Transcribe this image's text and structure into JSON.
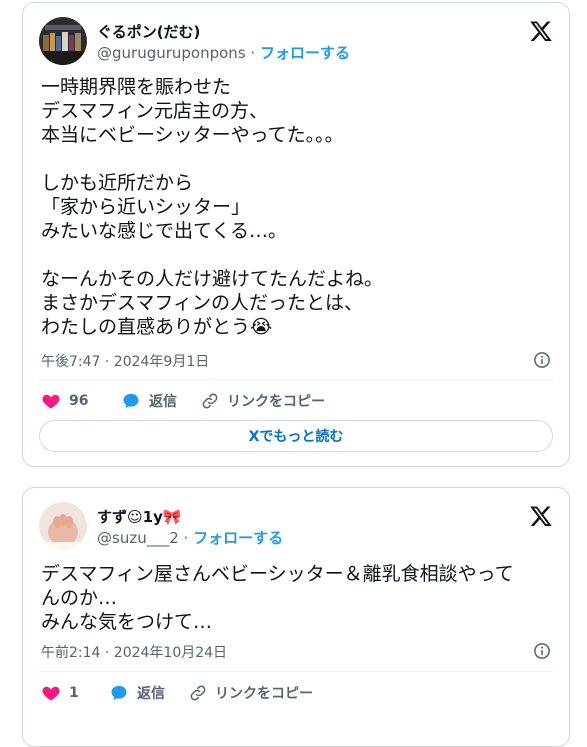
{
  "tweets": [
    {
      "display_name": "ぐるポン(だむ)",
      "handle": "@guruguruponpons",
      "separator": "·",
      "follow_label": "フォローする",
      "text": "一時期界隈を賑わせた\nデスマフィン元店主の方、\n本当にベビーシッターやってた。。。\n\nしかも近所だから\n「家から近いシッター」\nみたいな感じで出てくる…。\n\nなーんかその人だけ避けてたんだよね。\nまさかデスマフィンの人だったとは、\nわたしの直感ありがとう😭",
      "timestamp": "午後7:47 · 2024年9月1日",
      "like_count": "96",
      "reply_label": "返信",
      "copy_link_label": "リンクをコピー",
      "read_more_label": "Xでもっと読む"
    },
    {
      "display_name": "すず☺︎1y🎀",
      "handle": "@suzu___2",
      "separator": "·",
      "follow_label": "フォローする",
      "text": "デスマフィン屋さんベビーシッター＆離乳食相談やって\nんのか…\nみんな気をつけて…",
      "timestamp": "午前2:14 · 2024年10月24日",
      "like_count": "1",
      "reply_label": "返信",
      "copy_link_label": "リンクをコピー"
    }
  ],
  "icons": [
    "x-logo-icon",
    "info-icon",
    "heart-icon",
    "reply-bubble-icon",
    "link-icon"
  ],
  "colors": {
    "accent": "#1d9bf0",
    "heart": "#f91880",
    "muted": "#536471",
    "border": "#cfd9de"
  }
}
